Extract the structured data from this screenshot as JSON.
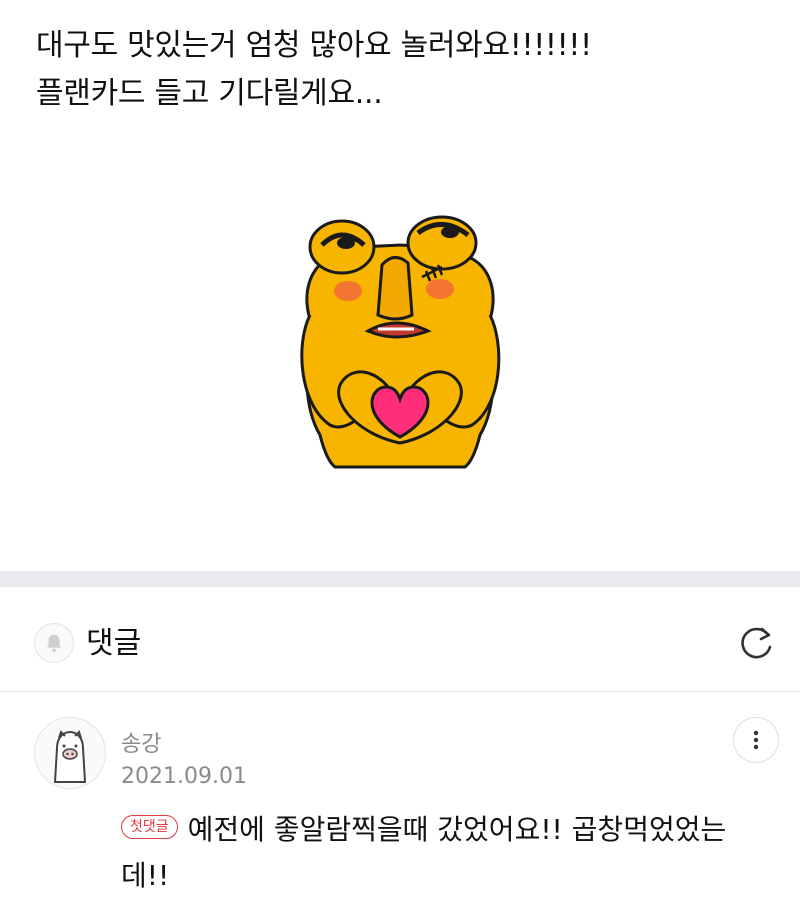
{
  "post": {
    "lines": [
      "대구도 맛있는거 엄청 많아요 놀러와요!!!!!!!",
      "플랜카드 들고 기다릴게요..."
    ],
    "sticker_icon": "bear-heart-sticker"
  },
  "comments_section": {
    "title": "댓글",
    "bell_icon": "bell-icon",
    "refresh_icon": "refresh-icon"
  },
  "comment": {
    "author": "송강",
    "date": "2021.09.01",
    "badge": "첫댓글",
    "text": "예전에 좋알람찍을때 갔었어요!! 곱창먹었었는데!!",
    "avatar_icon": "pig-avatar-icon",
    "more_icon": "more-vertical-icon"
  },
  "colors": {
    "divider": "#e9eaee",
    "badge_red": "#e0393e",
    "meta_gray": "#8a8a8a",
    "sticker_yellow": "#f7b500",
    "heart_pink": "#ff2e7a"
  }
}
